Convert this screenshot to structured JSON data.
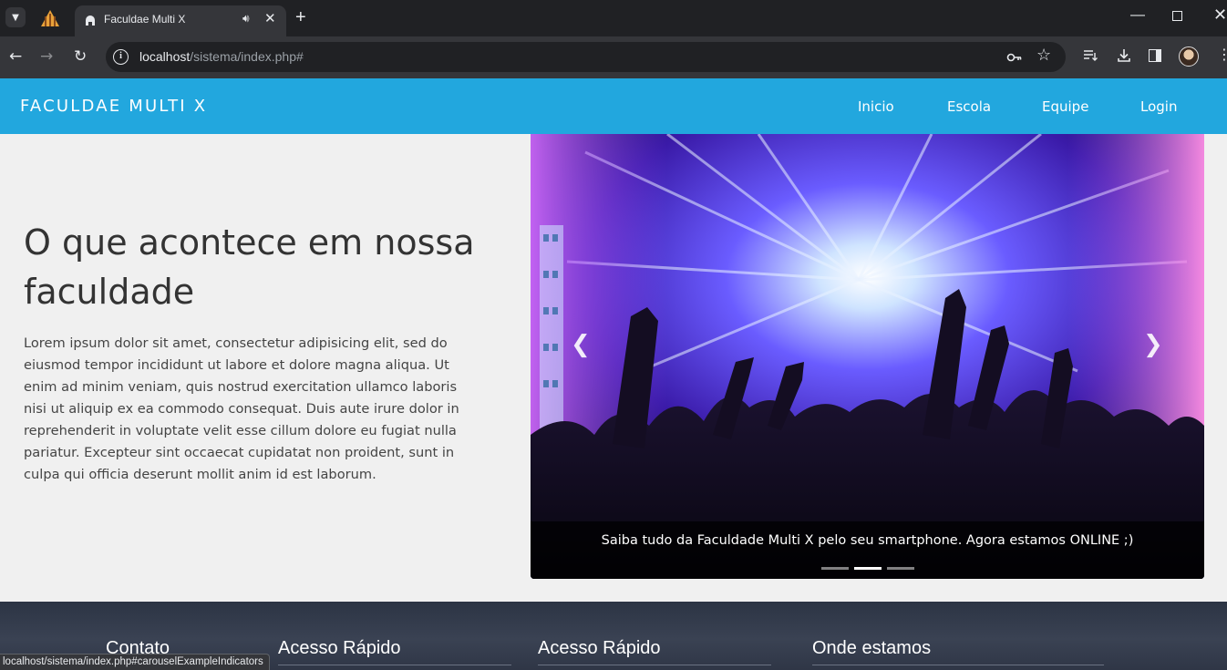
{
  "browser": {
    "tab_title": "Faculdae Multi X",
    "url_host": "localhost",
    "url_path": "/sistema/index.php#",
    "status_url": "localhost/sistema/index.php#carouselExampleIndicators"
  },
  "navbar": {
    "brand": "FACULDAE MULTI X",
    "links": [
      "Inicio",
      "Escola",
      "Equipe",
      "Login"
    ],
    "color": "#22a7de"
  },
  "hero": {
    "heading": "O que acontece em nossa faculdade",
    "text": "Lorem ipsum dolor sit amet, consectetur adipisicing elit, sed do eiusmod tempor incididunt ut labore et dolore magna aliqua. Ut enim ad minim veniam, quis nostrud exercitation ullamco laboris nisi ut aliquip ex ea commodo consequat. Duis aute irure dolor in reprehenderit in voluptate velit esse cillum dolore eu fugiat nulla pariatur. Excepteur sint occaecat cupidatat non proident, sunt in culpa qui officia deserunt mollit anim id est laborum."
  },
  "carousel": {
    "caption": "Saiba tudo da Faculdade Multi X pelo seu smartphone. Agora estamos ONLINE ;)",
    "active_index": 1,
    "slide_count": 3,
    "image_subject": "concert crowd with stage lights"
  },
  "footer": {
    "columns": [
      "Contato",
      "Acesso Rápido",
      "Acesso Rápido",
      "Onde estamos"
    ]
  }
}
